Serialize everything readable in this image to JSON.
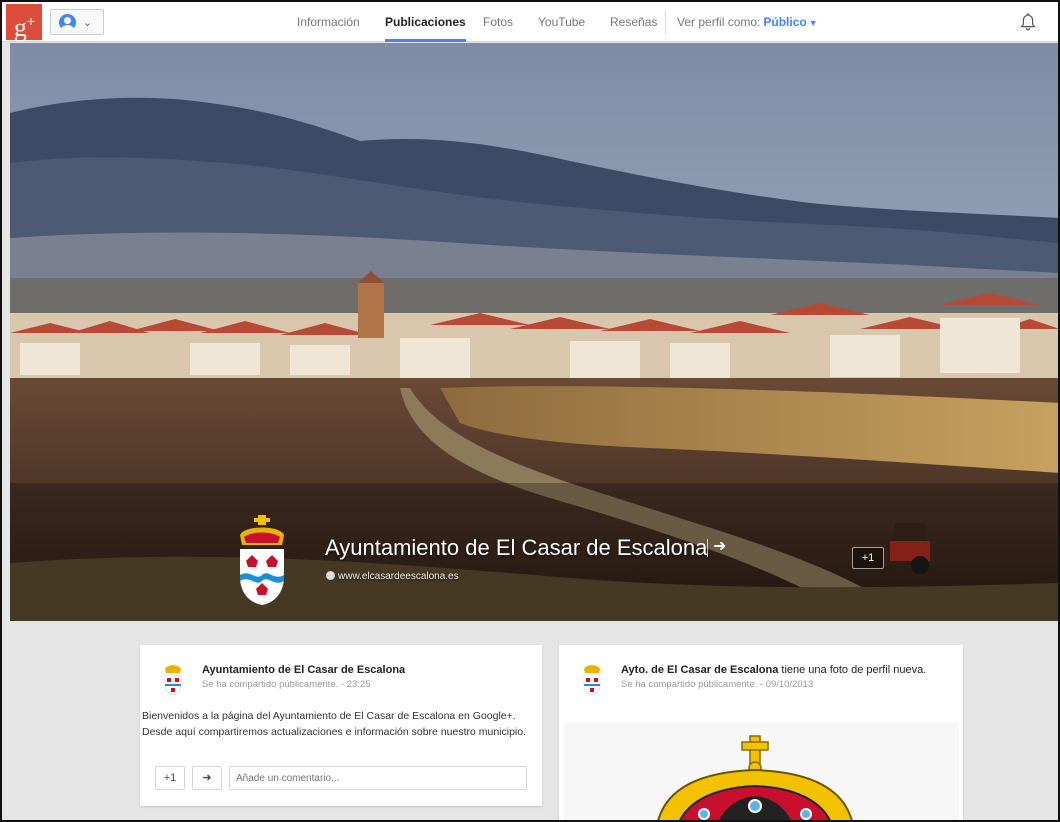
{
  "topbar": {
    "logo_text": "g+",
    "tabs": [
      {
        "label": "Información",
        "active": false
      },
      {
        "label": "Publicaciones",
        "active": true
      },
      {
        "label": "Fotos",
        "active": false
      },
      {
        "label": "YouTube",
        "active": false
      },
      {
        "label": "Reseñas",
        "active": false
      }
    ],
    "view_as_label": "Ver perfil como:",
    "view_as_value": "Público",
    "icons": [
      "account-icon",
      "chevron-down-icon",
      "bell-icon"
    ],
    "accent_color": "#4285f4",
    "brand_color": "#dd4b39"
  },
  "cover": {
    "page_name": "Ayuntamiento de El Casar de Escalona",
    "website": "www.elcasardeescalona.es",
    "plus_one": "+1"
  },
  "posts": [
    {
      "author": "Ayuntamiento de El Casar de Escalona",
      "suffix": "",
      "meta": "Se ha compartido públicamente.  -  23:25",
      "body_line1": "Bienvenidos a la página del Ayuntamiento de El Casar de Escalona en Google+.",
      "body_line2": "Desde aquí compartiremos actualizaciones e información sobre nuestro municipio.",
      "plus_one": "+1",
      "comment_placeholder": "Añade un comentario..."
    },
    {
      "author": "Ayto. de El Casar de Escalona",
      "suffix": " tiene una foto de perfil nueva.",
      "meta": "Se ha compartido públicamente.  -  09/10/2013"
    }
  ]
}
